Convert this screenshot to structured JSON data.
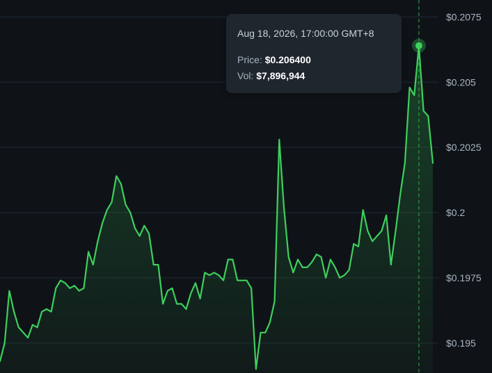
{
  "chart_data": {
    "type": "area",
    "ylim": [
      0.19385,
      0.20815
    ],
    "yticks": [
      {
        "value": 0.2075,
        "label": "$0.2075"
      },
      {
        "value": 0.205,
        "label": "$0.205"
      },
      {
        "value": 0.2025,
        "label": "$0.2025"
      },
      {
        "value": 0.2,
        "label": "$0.2"
      },
      {
        "value": 0.1975,
        "label": "$0.1975"
      },
      {
        "value": 0.195,
        "label": "$0.195"
      }
    ],
    "grid": true,
    "series": [
      {
        "values": [
          0.1943,
          0.195,
          0.197,
          0.1962,
          0.1956,
          0.1954,
          0.1952,
          0.1957,
          0.1956,
          0.1962,
          0.1963,
          0.1962,
          0.1971,
          0.1974,
          0.1973,
          0.1971,
          0.1972,
          0.197,
          0.1971,
          0.1985,
          0.198,
          0.1989,
          0.1996,
          0.2001,
          0.2004,
          0.2014,
          0.2011,
          0.2003,
          0.2,
          0.1994,
          0.1991,
          0.1995,
          0.1992,
          0.198,
          0.198,
          0.1965,
          0.197,
          0.1971,
          0.1965,
          0.1965,
          0.1963,
          0.1969,
          0.1973,
          0.1967,
          0.1977,
          0.1976,
          0.1977,
          0.1976,
          0.1974,
          0.1982,
          0.1982,
          0.1974,
          0.1974,
          0.1974,
          0.1971,
          0.194,
          0.1954,
          0.1954,
          0.1958,
          0.1966,
          0.2028,
          0.2002,
          0.1983,
          0.1977,
          0.1982,
          0.1979,
          0.1979,
          0.1981,
          0.1984,
          0.1983,
          0.1975,
          0.1982,
          0.1979,
          0.1975,
          0.1976,
          0.1978,
          0.1988,
          0.1987,
          0.2001,
          0.1993,
          0.1989,
          0.1991,
          0.1993,
          0.1999,
          0.198,
          0.1993,
          0.2007,
          0.2019,
          0.2048,
          0.2045,
          0.2064,
          0.2039,
          0.2037,
          0.2019
        ]
      }
    ],
    "highlight_index": 90,
    "line_color": "#3ecf5c"
  },
  "tooltip": {
    "date": "Aug 18, 2026, 17:00:00 GMT+8",
    "price_label": "Price:",
    "price_value": "$0.206400",
    "vol_label": "Vol:",
    "vol_value": "$7,896,944"
  }
}
